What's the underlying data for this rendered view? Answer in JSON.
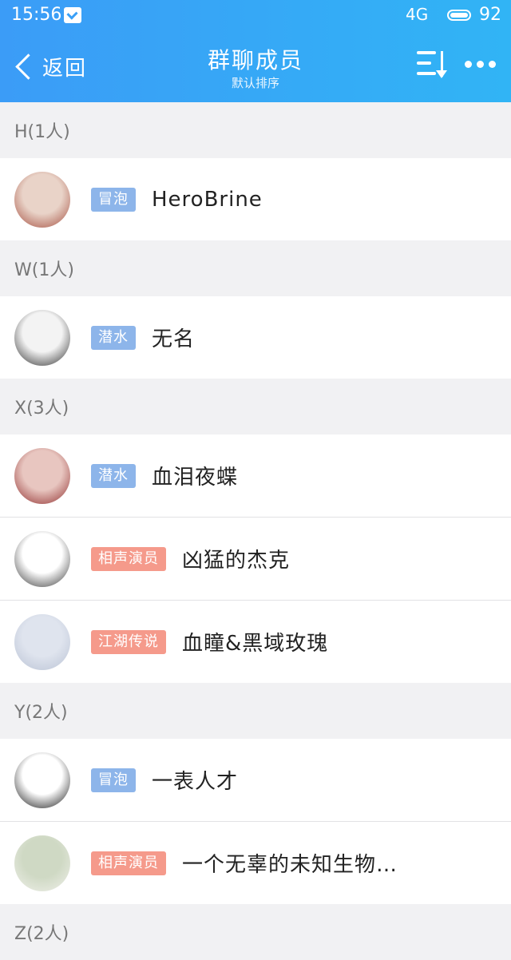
{
  "status_bar": {
    "time": "15:56",
    "signal": "4G",
    "battery": "92"
  },
  "header": {
    "back_label": "返回",
    "title": "群聊成员",
    "subtitle": "默认排序"
  },
  "sections": [
    {
      "label": "H(1人)",
      "members": [
        {
          "badge": "冒泡",
          "badge_color": "#8db5ea",
          "name": "HeroBrine",
          "avatar_colors": [
            "#e9d3c8",
            "#a34b3c"
          ]
        }
      ]
    },
    {
      "label": "W(1人)",
      "members": [
        {
          "badge": "潜水",
          "badge_color": "#8db5ea",
          "name": "无名",
          "avatar_colors": [
            "#f3f3f3",
            "#2a2a2a"
          ]
        }
      ]
    },
    {
      "label": "X(3人)",
      "members": [
        {
          "badge": "潜水",
          "badge_color": "#8db5ea",
          "name": "血泪夜蝶",
          "avatar_colors": [
            "#e8c6c0",
            "#8e2a2a"
          ]
        },
        {
          "badge": "相声演员",
          "badge_color": "#f59a8b",
          "name": "凶猛的杰克",
          "avatar_colors": [
            "#ffffff",
            "#333333"
          ]
        },
        {
          "badge": "江湖传说",
          "badge_color": "#f59a8b",
          "name": "血瞳&黑域玫瑰",
          "avatar_colors": [
            "#dfe4ee",
            "#b9c2d4"
          ]
        }
      ]
    },
    {
      "label": "Y(2人)",
      "members": [
        {
          "badge": "冒泡",
          "badge_color": "#8db5ea",
          "name": "一表人才",
          "avatar_colors": [
            "#ffffff",
            "#111111"
          ]
        },
        {
          "badge": "相声演员",
          "badge_color": "#f59a8b",
          "name": "一个无辜的未知生物…",
          "avatar_colors": [
            "#cfd9c4",
            "#f0f0ea"
          ]
        }
      ]
    },
    {
      "label": "Z(2人)",
      "members": []
    }
  ]
}
